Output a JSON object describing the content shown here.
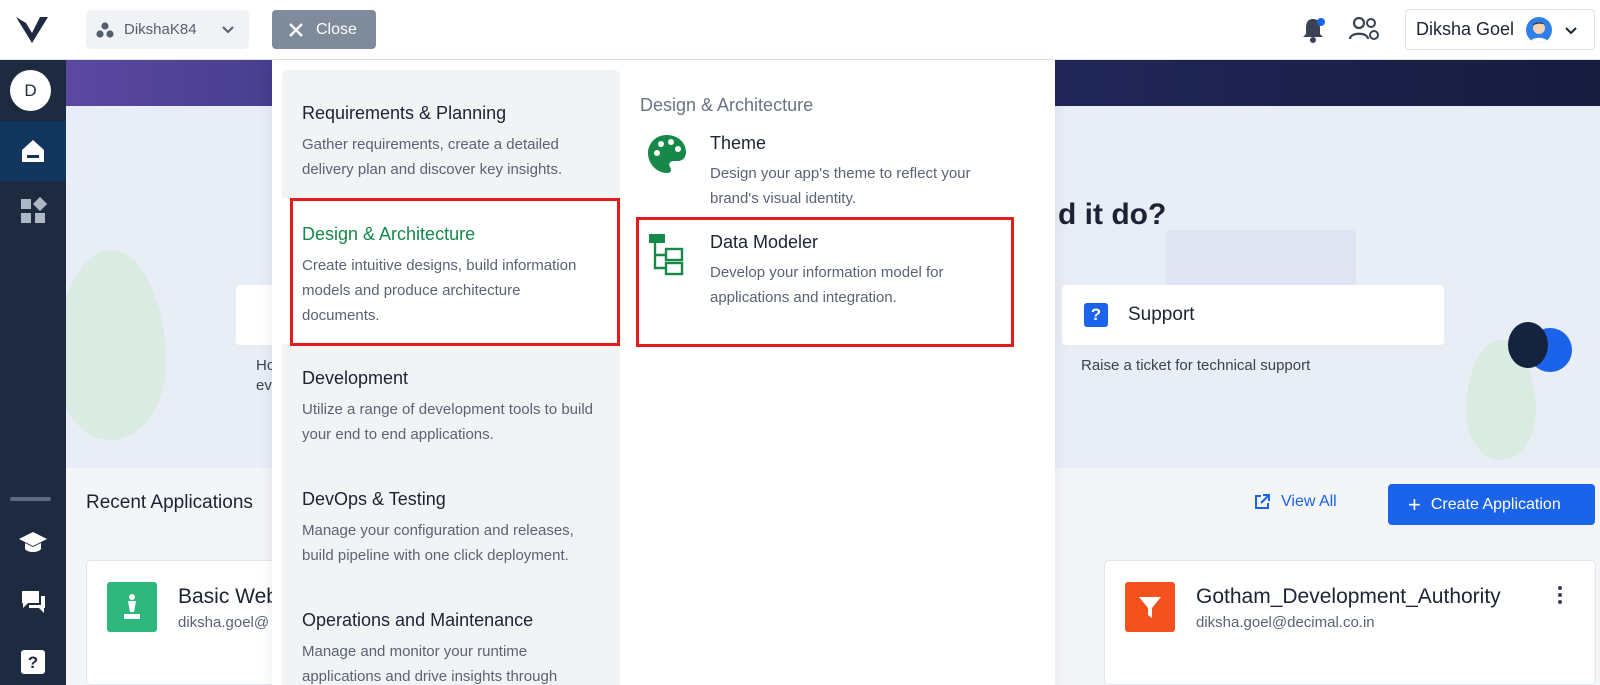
{
  "topbar": {
    "workspace": "DikshaK84",
    "close_label": "Close",
    "user_name": "Diksha Goel"
  },
  "sidebar": {
    "avatar_initial": "D"
  },
  "background": {
    "hero_title_partial": "d it do?",
    "support_title": "Support",
    "support_desc": "Raise a ticket for technical support",
    "partial_left_1": "Ho",
    "partial_left_2": "ev",
    "recent_title": "Recent Applications",
    "view_all": "View All",
    "create_application": "Create Application",
    "apps": [
      {
        "name": "Basic Web",
        "owner": "diksha.goel@"
      },
      {
        "name": "Gotham_Development_Authority",
        "owner": "diksha.goel@decimal.co.in"
      }
    ]
  },
  "menu": {
    "categories": [
      {
        "title": "Requirements & Planning",
        "desc": "Gather requirements, create a detailed delivery plan and discover key insights."
      },
      {
        "title": "Design & Architecture",
        "desc": "Create intuitive designs, build information models and produce architecture documents."
      },
      {
        "title": "Development",
        "desc": "Utilize a range of development tools to build your end to end applications."
      },
      {
        "title": "DevOps & Testing",
        "desc": "Manage your configuration and releases, build pipeline with one click deployment."
      },
      {
        "title": "Operations and Maintenance",
        "desc": "Manage and monitor your runtime applications and drive insights through"
      }
    ],
    "right_heading": "Design & Architecture",
    "tools": [
      {
        "title": "Theme",
        "desc": "Design your app's theme to reflect your brand's visual identity."
      },
      {
        "title": "Data Modeler",
        "desc": "Develop your information model for applications and integration."
      }
    ]
  },
  "colors": {
    "accent": "#1b63e8",
    "active_green": "#15884a",
    "sidebar": "#1d2a3f",
    "highlight": "#e41c1c"
  }
}
